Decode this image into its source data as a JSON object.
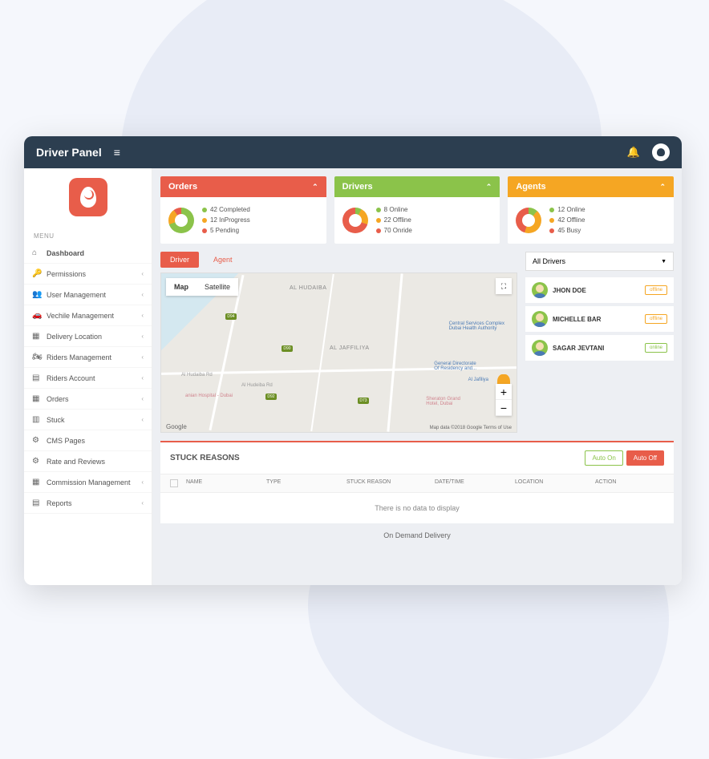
{
  "header": {
    "title": "Driver Panel"
  },
  "sidebar": {
    "section_label": "MENU",
    "items": [
      {
        "label": "Dashboard",
        "expandable": false
      },
      {
        "label": "Permissions",
        "expandable": true
      },
      {
        "label": "User Management",
        "expandable": true
      },
      {
        "label": "Vechile Management",
        "expandable": true
      },
      {
        "label": "Delivery Location",
        "expandable": true
      },
      {
        "label": "Riders Management",
        "expandable": true
      },
      {
        "label": "Riders Account",
        "expandable": true
      },
      {
        "label": "Orders",
        "expandable": true
      },
      {
        "label": "Stuck",
        "expandable": true
      },
      {
        "label": "CMS Pages",
        "expandable": false
      },
      {
        "label": "Rate and Reviews",
        "expandable": false
      },
      {
        "label": "Commission Management",
        "expandable": true
      },
      {
        "label": "Reports",
        "expandable": true
      }
    ]
  },
  "cards": {
    "orders": {
      "title": "Orders",
      "stats": [
        {
          "value": "42 Completed",
          "color": "green"
        },
        {
          "value": "12 InProgress",
          "color": "orange"
        },
        {
          "value": "5 Pending",
          "color": "red"
        }
      ]
    },
    "drivers": {
      "title": "Drivers",
      "stats": [
        {
          "value": "8 Online",
          "color": "green"
        },
        {
          "value": "22 Offline",
          "color": "orange"
        },
        {
          "value": "70 Onride",
          "color": "red"
        }
      ]
    },
    "agents": {
      "title": "Agents",
      "stats": [
        {
          "value": "12 Online",
          "color": "green"
        },
        {
          "value": "42 Offline",
          "color": "orange"
        },
        {
          "value": "45 Busy",
          "color": "red"
        }
      ]
    }
  },
  "map_tabs": {
    "driver": "Driver",
    "agent": "Agent"
  },
  "map": {
    "view_map": "Map",
    "view_satellite": "Satellite",
    "labels": {
      "hudaiba": "AL HUDAIBA",
      "jaffiliya": "AL JAFFILIYA"
    },
    "poi": {
      "services": "Central Services Complex\nDubai Health Authority",
      "directorate": "General Directorate\nOf Residency and...",
      "hospital": "anian Hospital - Dubai",
      "sheraton": "Sheraton Grand\nHotel, Dubai",
      "jafiliya_station": "Al Jafiliya"
    },
    "roads": {
      "hudaiba_rd": "Al Hudaiba Rd",
      "hudeiba_rd": "Al Hudeiba Rd"
    },
    "google": "Google",
    "credits": "Map data ©2018 Google    Terms of Use"
  },
  "driver_filter": {
    "selected": "All Drivers"
  },
  "drivers_list": [
    {
      "name": "JHON DOE",
      "status": "offline"
    },
    {
      "name": "MICHELLE BAR",
      "status": "offline"
    },
    {
      "name": "SAGAR JEVTANI",
      "status": "online"
    }
  ],
  "stuck": {
    "title": "STUCK REASONS",
    "auto_on": "Auto On",
    "auto_off": "Auto Off",
    "columns": {
      "name": "NAME",
      "type": "TYPE",
      "reason": "STUCK REASON",
      "date": "DATE/TIME",
      "location": "LOCATION",
      "action": "ACTION"
    },
    "empty": "There is no data to display"
  },
  "footer": {
    "text": "On Demand Delivery"
  }
}
